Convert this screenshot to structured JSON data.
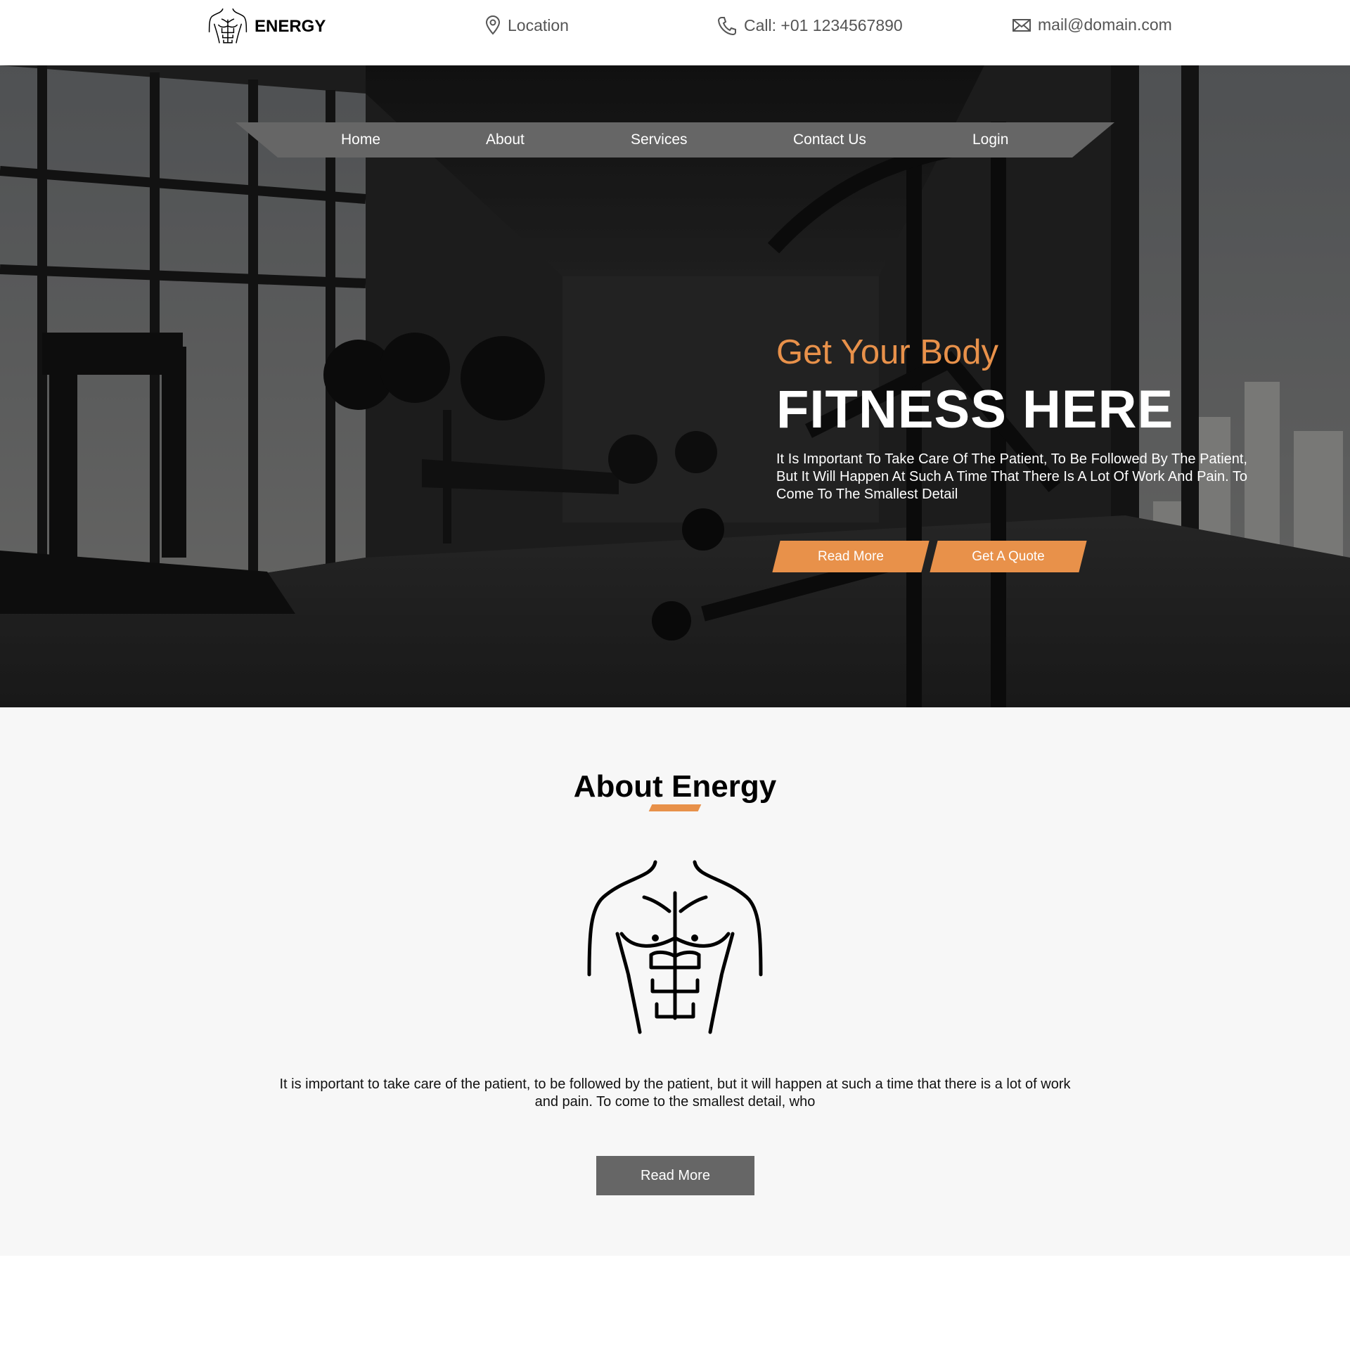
{
  "brand": {
    "name": "ENERGY",
    "logo_icon": "muscle-torso-icon"
  },
  "contact": {
    "location": {
      "icon": "location-pin-icon",
      "text": "Location"
    },
    "call": {
      "icon": "phone-icon",
      "text": "Call: +01 1234567890"
    },
    "mail": {
      "icon": "envelope-icon",
      "text": "mail@domain.com"
    }
  },
  "nav": {
    "items": [
      "Home",
      "About",
      "Services",
      "Contact Us",
      "Login"
    ]
  },
  "hero": {
    "subtitle": "Get Your Body",
    "title": "FITNESS HERE",
    "description": "It Is Important To Take Care Of The Patient, To Be Followed By The Patient, But It Will Happen At Such A Time That There Is A Lot Of Work And Pain. To Come To The Smallest Detail",
    "buttons": [
      "Read More",
      "Get A Quote"
    ]
  },
  "about": {
    "title": "About Energy",
    "icon": "muscle-torso-icon",
    "description": "It is important to take care of the patient, to be followed by the patient, but it will happen at such a time that there is a lot of work and pain. To come to the smallest detail, who",
    "button": "Read More"
  },
  "colors": {
    "accent": "#e8914a",
    "nav_bg": "#666666",
    "about_bg": "#f7f7f7"
  }
}
